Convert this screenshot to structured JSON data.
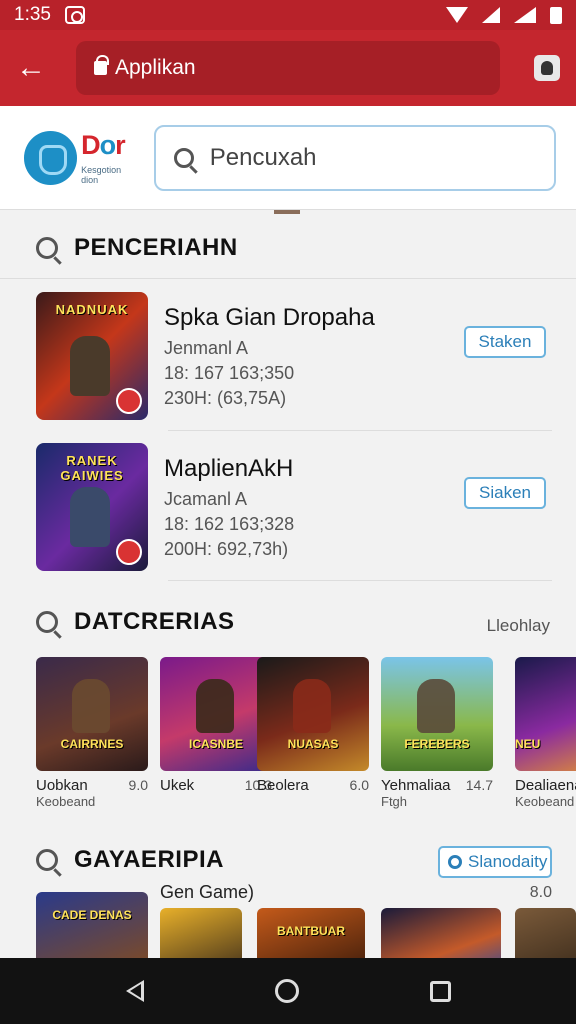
{
  "status_bar": {
    "time": "1:35"
  },
  "browser": {
    "url": "Applikan"
  },
  "header": {
    "logo_word_red": "D",
    "logo_word_blue": "o",
    "logo_word_red2": "r",
    "logo_sub": "Kesgotion dion",
    "search_placeholder": "Pencuxah"
  },
  "section1": {
    "title": "PENCERIAHN",
    "results": [
      {
        "name": "Spka Gian Dropaha",
        "dev": "Jenmanl A",
        "line1": "18: 167 163;350",
        "line2": "230H: (63,75A)",
        "button": "Staken",
        "thumb_title": "NADNUAK"
      },
      {
        "name": "MaplienAkH",
        "dev": "Jcamanl A",
        "line1": "18: 162 163;328",
        "line2": "200H: 692,73h)",
        "button": "Siaken",
        "thumb_title": "RANEK GAIWIES"
      }
    ]
  },
  "section2": {
    "title": "DATCRERIAS",
    "see_more": "Lleohlay",
    "tiles": [
      {
        "name": "Uobkan",
        "dev": "Keobeand",
        "num": "9.0",
        "img_title": "CAIRRNES"
      },
      {
        "name": "Ukek",
        "dev": "",
        "num": "10.3",
        "img_title": "ICASNBE"
      },
      {
        "name": "Beolera",
        "dev": "",
        "num": "6.0",
        "img_title": "NUASAS"
      },
      {
        "name": "Yehmaliaa",
        "dev": "Ftgh",
        "num": "14.7",
        "img_title": "FEREBERS"
      },
      {
        "name": "Dealiaena",
        "dev": "Keobeand",
        "num": "",
        "img_title": "NEU"
      }
    ]
  },
  "section3": {
    "title": "GAYAERIPIA",
    "chip": "Slanodaity",
    "sub_label": "Gen Game)",
    "sub_num": "8.0",
    "minis": [
      "CADE DENAS",
      "",
      "BANTBUAR",
      "",
      ""
    ]
  },
  "colors": {
    "accent": "#c4262e",
    "link": "#2b7fb8"
  }
}
